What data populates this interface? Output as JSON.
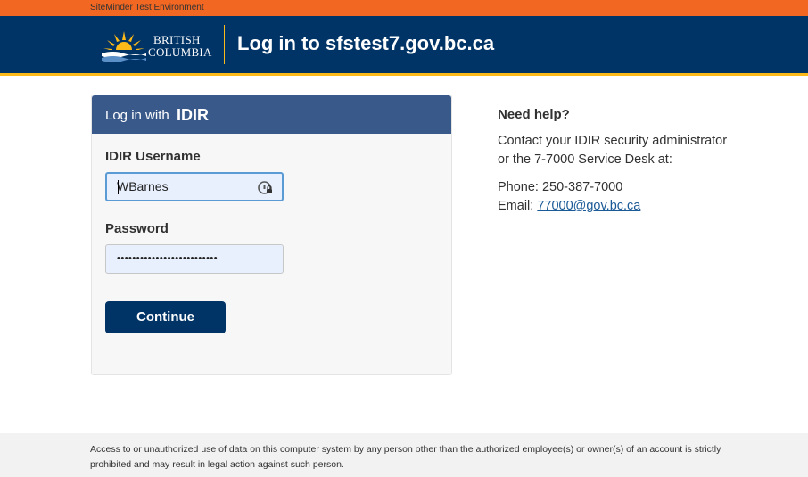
{
  "environment_banner": "SiteMinder Test Environment",
  "header": {
    "logo_line1": "BRITISH",
    "logo_line2": "COLUMBIA",
    "title": "Log in to sfstest7.gov.bc.ca"
  },
  "login_panel": {
    "heading_prefix": "Log in with",
    "heading_emphasis": "IDIR",
    "username_label": "IDIR Username",
    "username_value": "WBarnes",
    "password_label": "Password",
    "password_masked": "••••••••••••••••••••••••••",
    "continue_label": "Continue"
  },
  "help": {
    "title": "Need help?",
    "line1": "Contact your IDIR security administrator",
    "line2": "or the 7-7000 Service Desk at:",
    "phone": "Phone: 250-387-7000",
    "email_prefix": "Email: ",
    "email_link": "77000@gov.bc.ca"
  },
  "footer": {
    "notice": "Access to or unauthorized use of data on this computer system by any person other than the authorized employee(s) or owner(s) of an account is strictly prohibited and may result in legal action against such person."
  },
  "icons": {
    "logo": "bc-sun-logo",
    "password_manager": "password-manager-icon"
  },
  "colors": {
    "env_bar": "#f26722",
    "header_bg": "#003366",
    "accent_gold": "#fcba19",
    "panel_header": "#38598a",
    "button_bg": "#003366",
    "link": "#1a5a96"
  }
}
